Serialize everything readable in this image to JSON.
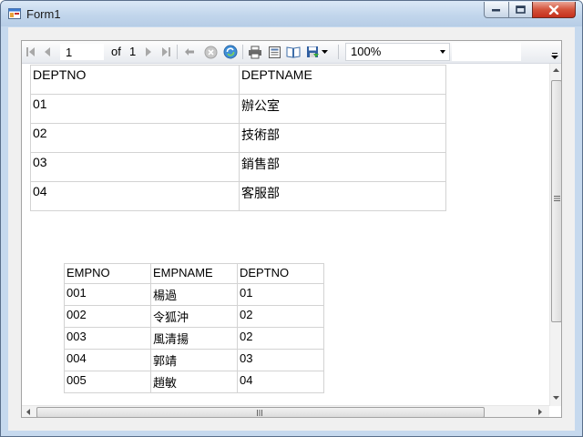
{
  "window": {
    "title": "Form1"
  },
  "toolbar": {
    "page_current": "1",
    "of_label": "of",
    "page_total": "1",
    "zoom": "100%"
  },
  "dept_table": {
    "headers": [
      "DEPTNO",
      "DEPTNAME"
    ],
    "rows": [
      [
        "01",
        "辦公室"
      ],
      [
        "02",
        "技術部"
      ],
      [
        "03",
        "銷售部"
      ],
      [
        "04",
        "客服部"
      ]
    ]
  },
  "emp_table": {
    "headers": [
      "EMPNO",
      "EMPNAME",
      "DEPTNO"
    ],
    "rows": [
      [
        "001",
        "楊過",
        "01"
      ],
      [
        "002",
        "令狐沖",
        "02"
      ],
      [
        "003",
        "風清揚",
        "02"
      ],
      [
        "004",
        "郭靖",
        "03"
      ],
      [
        "005",
        "趙敏",
        "04"
      ]
    ]
  }
}
